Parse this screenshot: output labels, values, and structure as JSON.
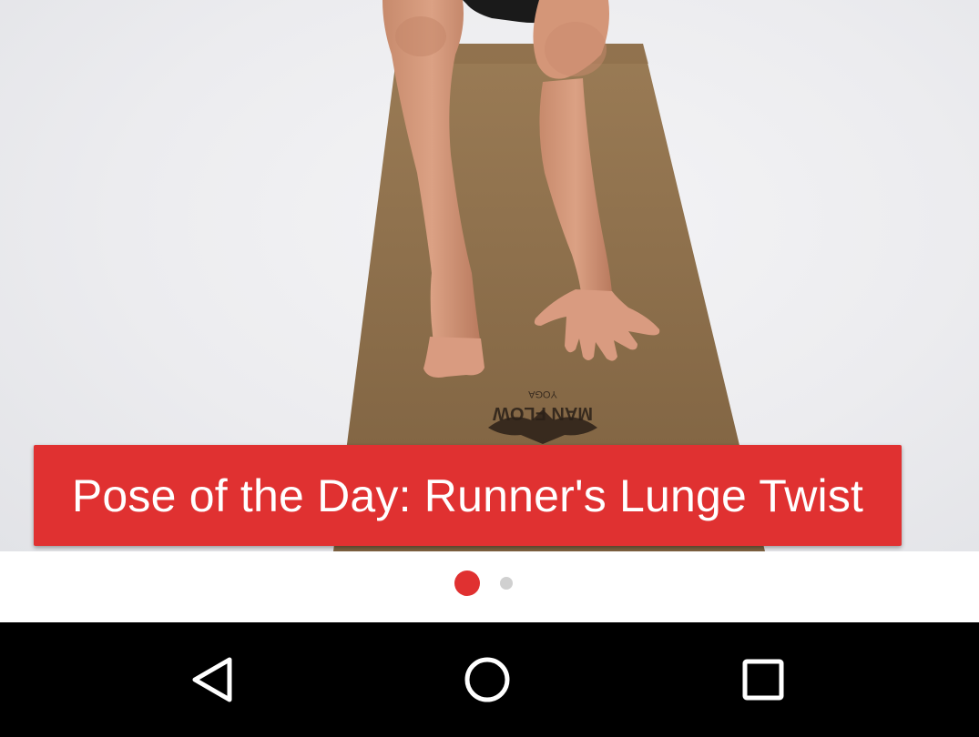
{
  "hero": {
    "mat_logo_text": "MAN FLOW",
    "mat_logo_subtext": "YOGA"
  },
  "caption": {
    "title": "Pose of the Day: Runner's Lunge Twist"
  },
  "pager": {
    "page_count": 2,
    "active_index": 0,
    "active_color": "#e03131",
    "inactive_color": "#d0d0d0"
  },
  "nav_bar": {
    "buttons": [
      "back",
      "home",
      "recents"
    ]
  },
  "colors": {
    "accent": "#e03131",
    "nav_background": "#000000"
  }
}
